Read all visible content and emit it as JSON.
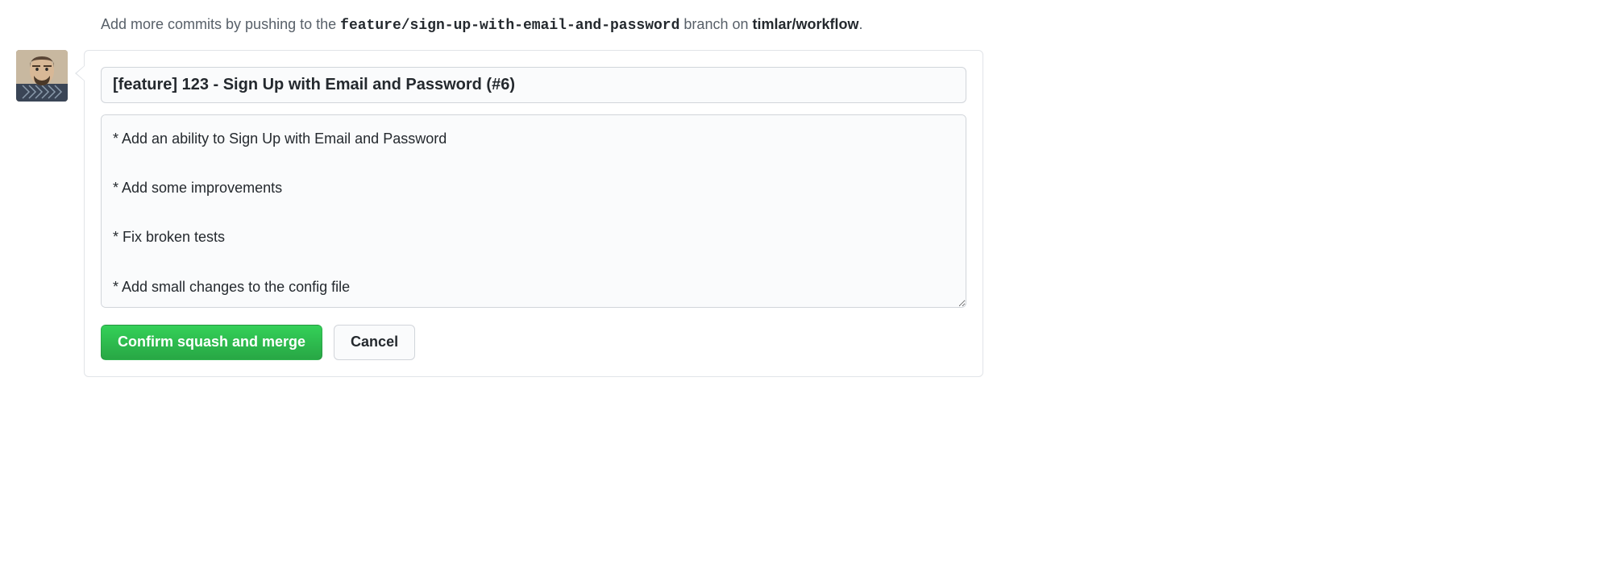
{
  "hint": {
    "prefix": "Add more commits by pushing to the ",
    "branch": "feature/sign-up-with-email-and-password",
    "middle": " branch on ",
    "repo": "timlar/workflow",
    "suffix": "."
  },
  "commit": {
    "title": "[feature] 123 - Sign Up with Email and Password (#6)",
    "body": "* Add an ability to Sign Up with Email and Password\n\n* Add some improvements\n\n* Fix broken tests\n\n* Add small changes to the config file"
  },
  "actions": {
    "confirm": "Confirm squash and merge",
    "cancel": "Cancel"
  }
}
